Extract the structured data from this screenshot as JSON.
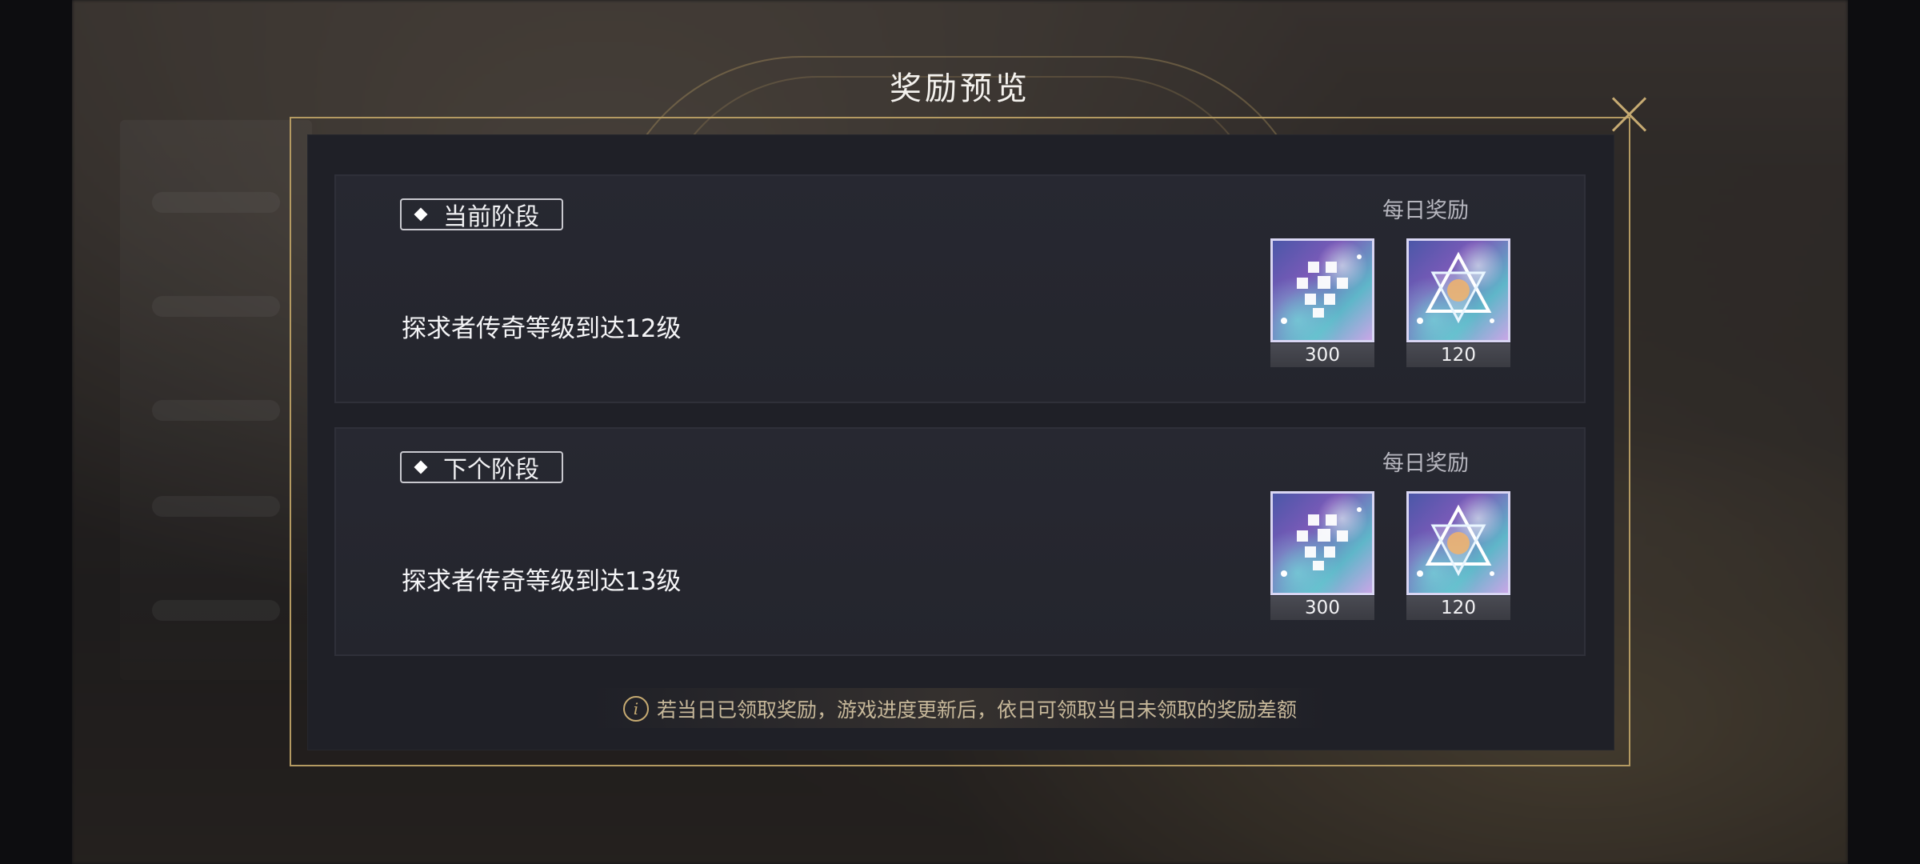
{
  "title": "奖励预览",
  "stages": [
    {
      "tag": "当前阶段",
      "description": "探求者传奇等级到达12级",
      "daily_label": "每日奖励",
      "rewards": [
        {
          "icon": "fragment-crystal-icon",
          "count": "300"
        },
        {
          "icon": "star-crystal-icon",
          "count": "120"
        }
      ]
    },
    {
      "tag": "下个阶段",
      "description": "探求者传奇等级到达13级",
      "daily_label": "每日奖励",
      "rewards": [
        {
          "icon": "fragment-crystal-icon",
          "count": "300"
        },
        {
          "icon": "star-crystal-icon",
          "count": "120"
        }
      ]
    }
  ],
  "notice": "若当日已领取奖励，游戏进度更新后，依日可领取当日未领取的奖励差额",
  "colors": {
    "gold": "#c7ab72",
    "panel": "#1f2027",
    "card": "#272831"
  }
}
